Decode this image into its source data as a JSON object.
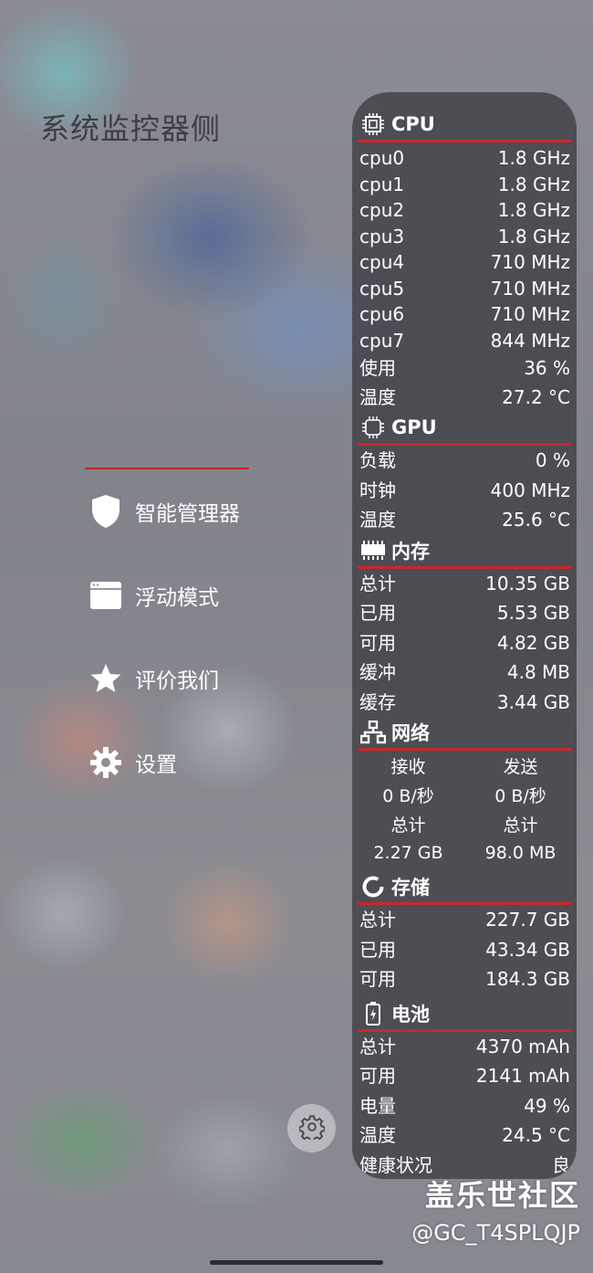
{
  "left_panel": {
    "title": "系统监控器侧",
    "menu": [
      {
        "label": "智能管理器",
        "icon": "shield-icon"
      },
      {
        "label": "浮动模式",
        "icon": "window-icon"
      },
      {
        "label": "评价我们",
        "icon": "star-icon"
      },
      {
        "label": "设置",
        "icon": "gear-icon"
      }
    ]
  },
  "monitor": {
    "cpu": {
      "title": "CPU",
      "rows": [
        {
          "label": "cpu0",
          "value": "1.8 GHz"
        },
        {
          "label": "cpu1",
          "value": "1.8 GHz"
        },
        {
          "label": "cpu2",
          "value": "1.8 GHz"
        },
        {
          "label": "cpu3",
          "value": "1.8 GHz"
        },
        {
          "label": "cpu4",
          "value": "710 MHz"
        },
        {
          "label": "cpu5",
          "value": "710 MHz"
        },
        {
          "label": "cpu6",
          "value": "710 MHz"
        },
        {
          "label": "cpu7",
          "value": "844 MHz"
        },
        {
          "label": "使用",
          "value": "36 %"
        },
        {
          "label": "温度",
          "value": "27.2 °C"
        }
      ]
    },
    "gpu": {
      "title": "GPU",
      "rows": [
        {
          "label": "负载",
          "value": "0 %"
        },
        {
          "label": "时钟",
          "value": "400 MHz"
        },
        {
          "label": "温度",
          "value": "25.6 °C"
        }
      ]
    },
    "memory": {
      "title": "内存",
      "rows": [
        {
          "label": "总计",
          "value": "10.35 GB"
        },
        {
          "label": "已用",
          "value": "5.53 GB"
        },
        {
          "label": "可用",
          "value": "4.82 GB"
        },
        {
          "label": "缓冲",
          "value": "4.8 MB"
        },
        {
          "label": "缓存",
          "value": "3.44 GB"
        }
      ]
    },
    "network": {
      "title": "网络",
      "receive_label": "接收",
      "send_label": "发送",
      "receive_rate": "0 B/秒",
      "send_rate": "0 B/秒",
      "total_label_rx": "总计",
      "total_label_tx": "总计",
      "receive_total": "2.27 GB",
      "send_total": "98.0 MB"
    },
    "storage": {
      "title": "存储",
      "rows": [
        {
          "label": "总计",
          "value": "227.7 GB"
        },
        {
          "label": "已用",
          "value": "43.34 GB"
        },
        {
          "label": "可用",
          "value": "184.3 GB"
        }
      ]
    },
    "battery": {
      "title": "电池",
      "rows": [
        {
          "label": "总计",
          "value": "4370 mAh"
        },
        {
          "label": "可用",
          "value": "2141 mAh"
        },
        {
          "label": "电量",
          "value": "49 %"
        },
        {
          "label": "温度",
          "value": "24.5 °C"
        }
      ],
      "cut_off_row": {
        "label": "健康状况",
        "value": "良"
      }
    }
  },
  "watermark": {
    "line1": "盖乐世社区",
    "line2": "@GC_T4SPLQJP"
  },
  "colors": {
    "accent_red": "#c8282c",
    "panel_bg": "#48484e",
    "text": "#ffffff"
  }
}
